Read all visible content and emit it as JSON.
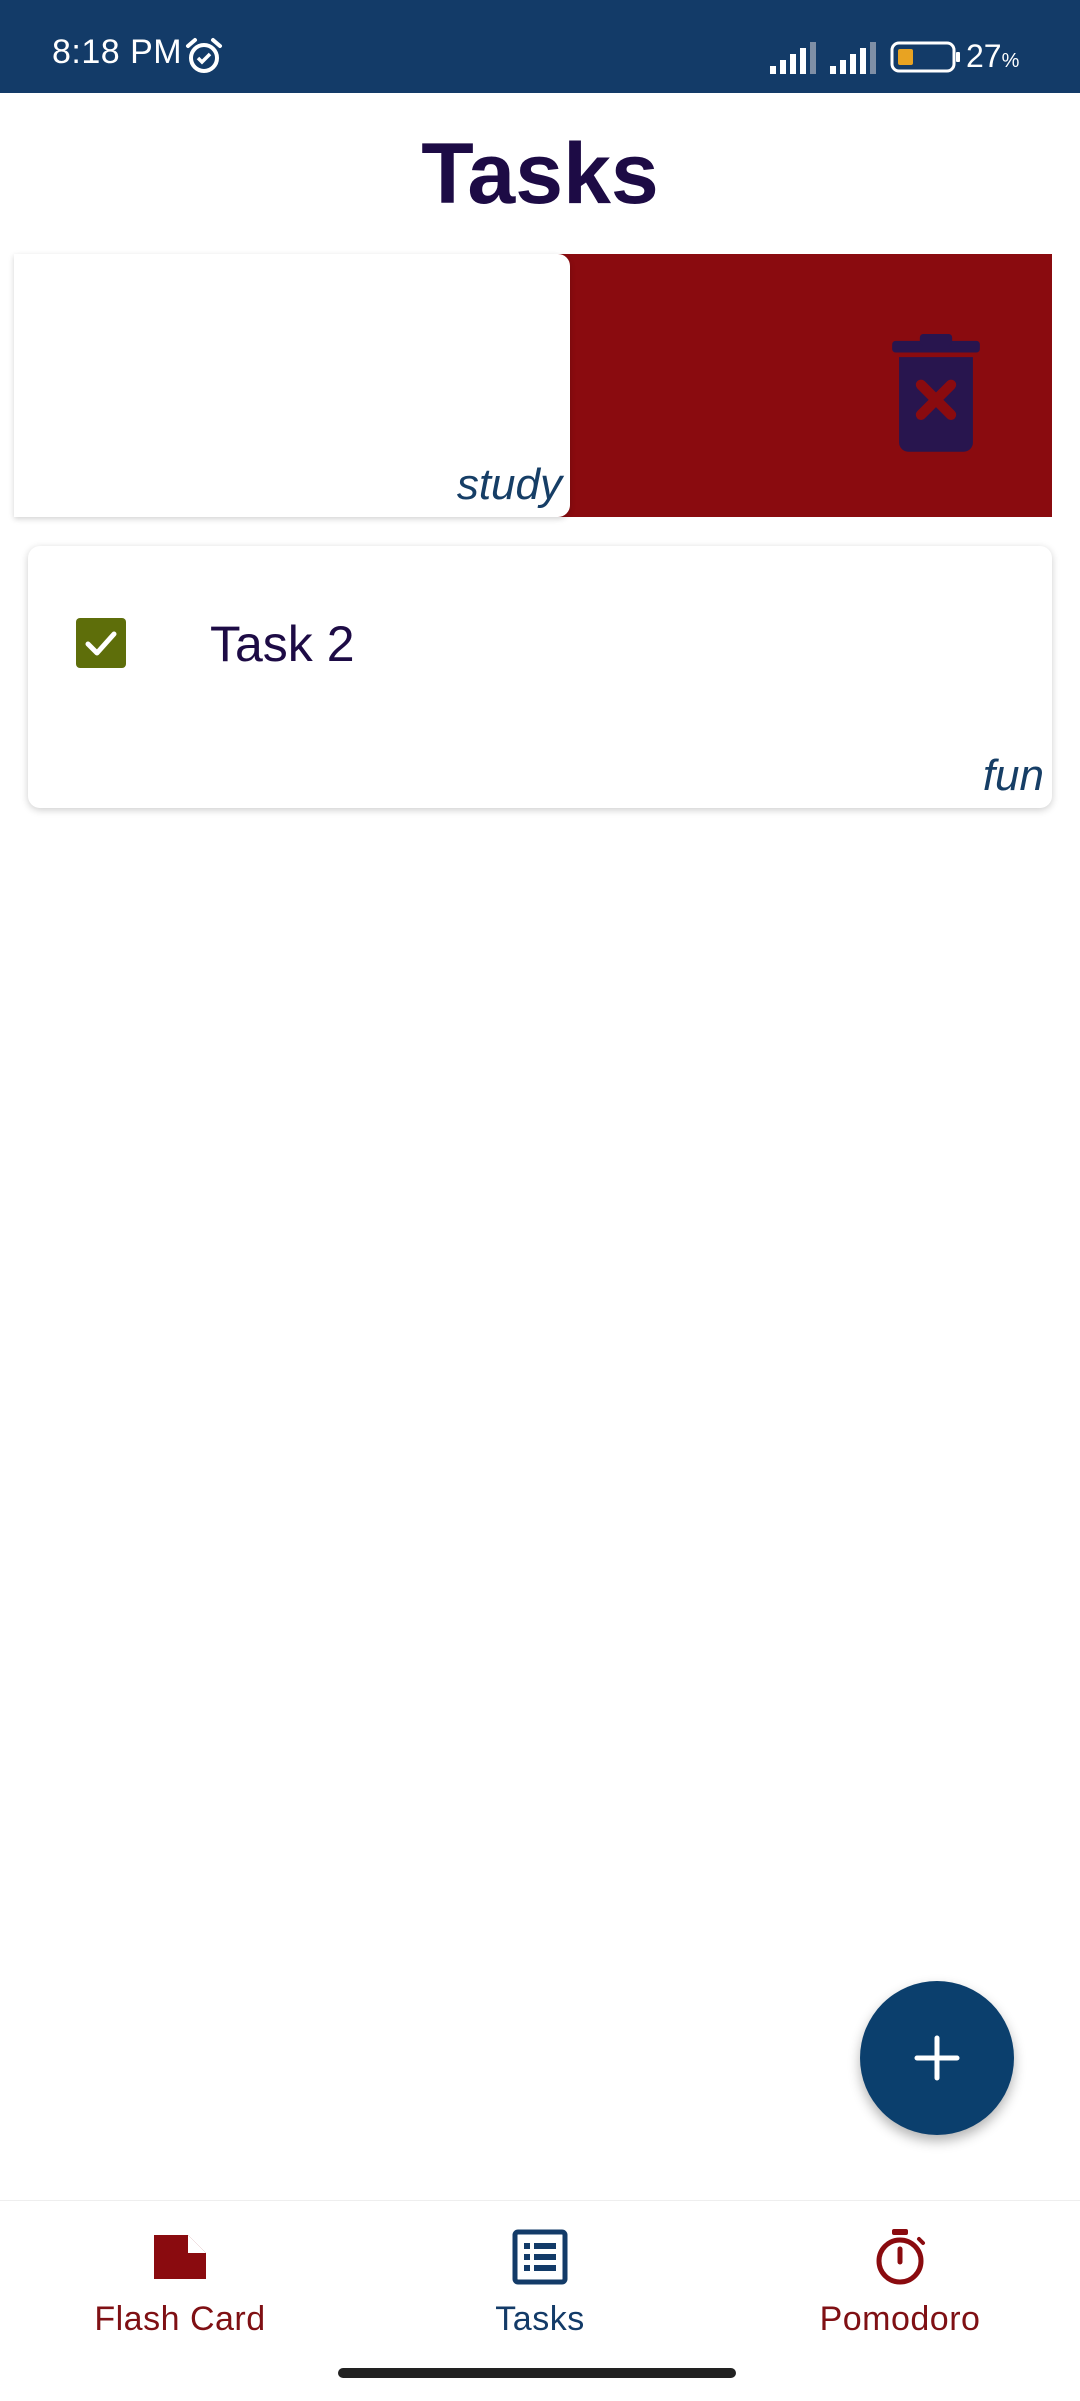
{
  "status_bar": {
    "time": "8:18 PM",
    "battery_value": "27",
    "battery_unit": "%",
    "icons": [
      "alarm-icon",
      "signal-icon",
      "signal-icon",
      "battery-icon"
    ]
  },
  "page": {
    "title": "Tasks"
  },
  "tasks": [
    {
      "title": "",
      "tag": "study",
      "state": "swiped-to-delete"
    },
    {
      "title": "Task 2",
      "tag": "fun",
      "checked": true
    }
  ],
  "swipe_action": {
    "icon": "delete-icon",
    "color": "#8a0b0f"
  },
  "fab": {
    "icon": "plus-icon"
  },
  "bottom_nav": {
    "items": [
      {
        "label": "Flash Card",
        "icon": "flash-card-icon",
        "color": "#7f1014"
      },
      {
        "label": "Tasks",
        "icon": "task-list-icon",
        "color": "#133b68",
        "selected": true
      },
      {
        "label": "Pomodoro",
        "icon": "stopwatch-icon",
        "color": "#7f1014"
      }
    ]
  },
  "colors": {
    "status_bar": "#133b68",
    "title_text": "#1d0b45",
    "checkbox": "#5e6e0a",
    "fab": "#0b3f6d"
  }
}
